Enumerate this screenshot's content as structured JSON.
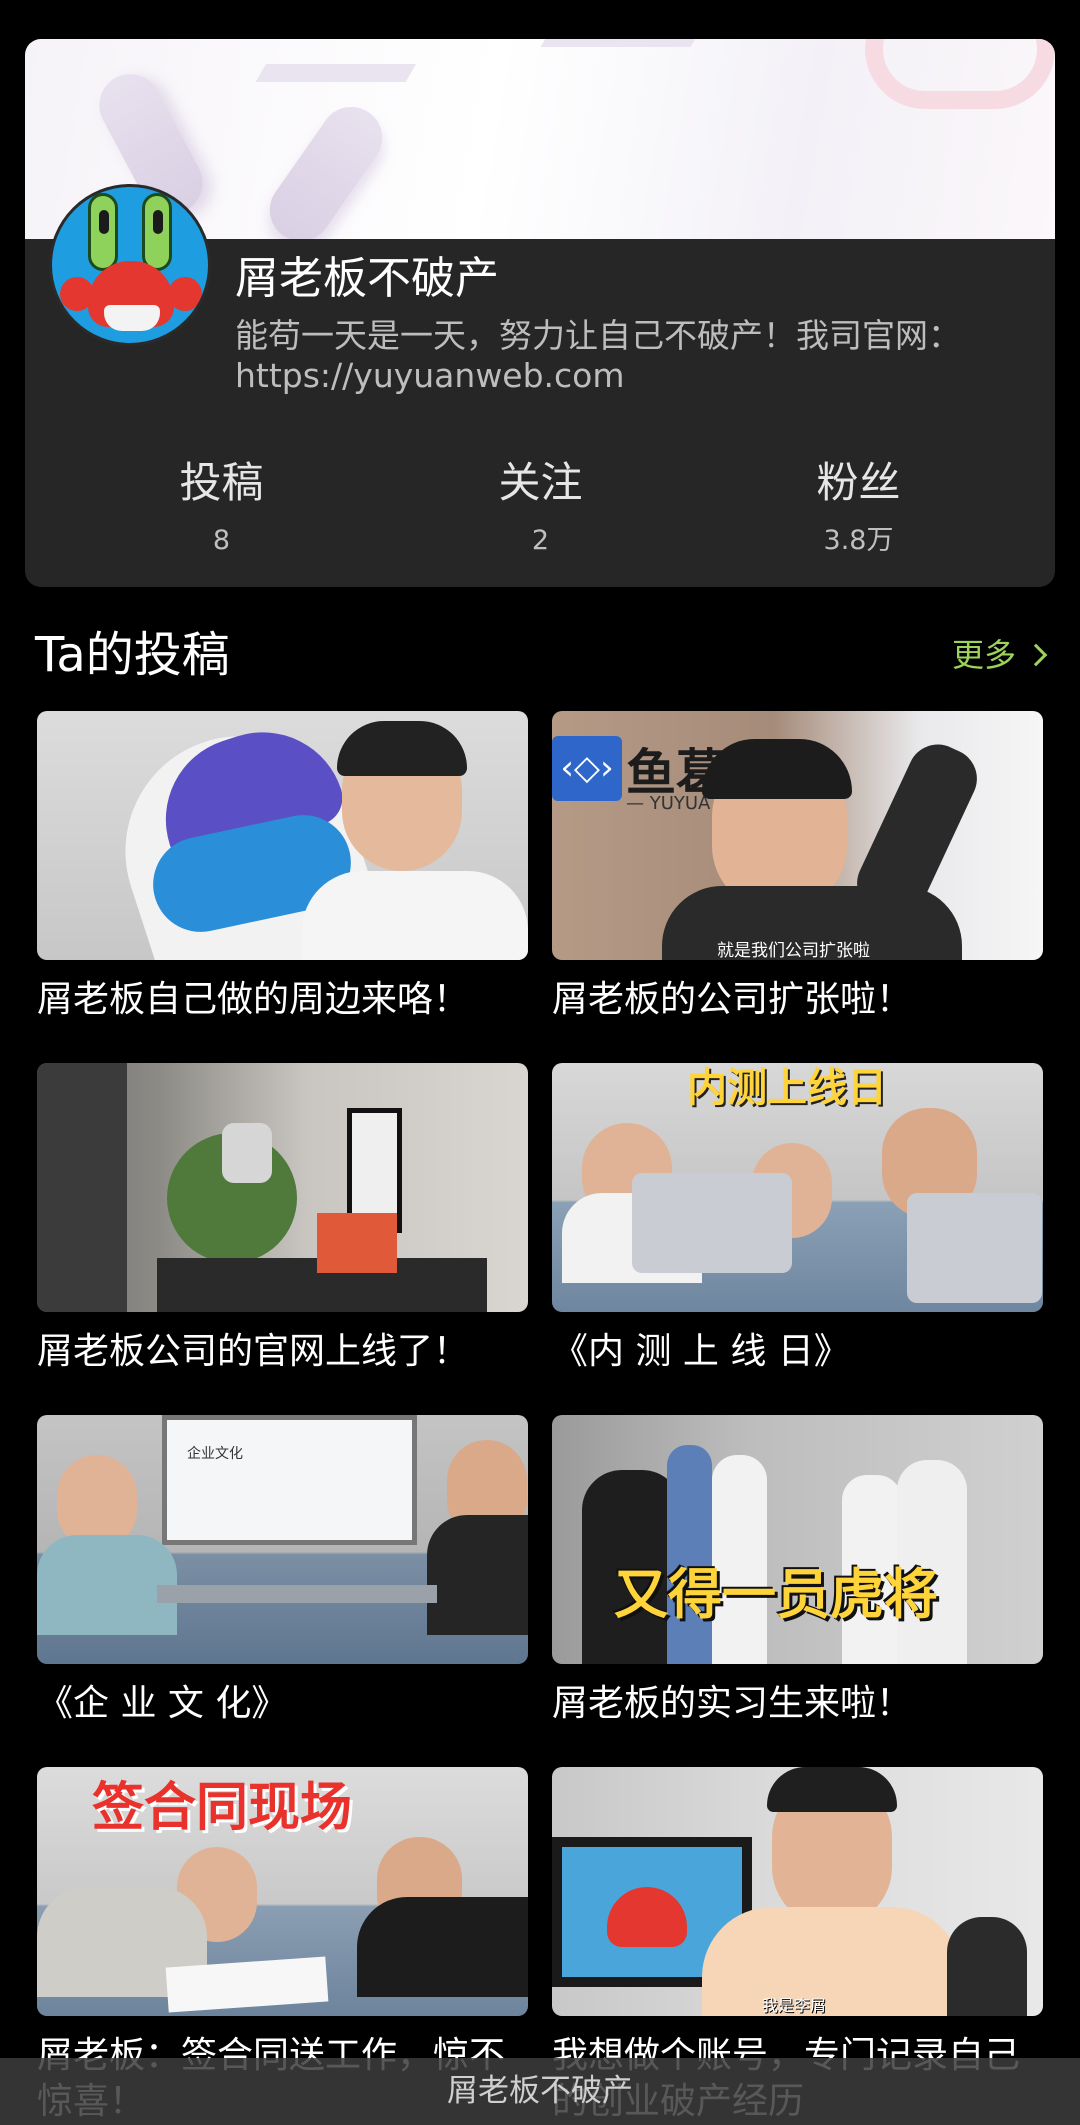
{
  "profile": {
    "name": "屑老板不破产",
    "bio": "能苟一天是一天，努力让自己不破产！我司官网：https://yuyuanweb.com",
    "stats": [
      {
        "label": "投稿",
        "value": "8"
      },
      {
        "label": "关注",
        "value": "2"
      },
      {
        "label": "粉丝",
        "value": "3.8万"
      }
    ]
  },
  "section": {
    "title": "Ta的投稿",
    "more_label": "更多"
  },
  "videos": [
    {
      "title": "屑老板自己做的周边来咯！",
      "overlay": ""
    },
    {
      "title": "屑老板的公司扩张啦！",
      "overlay": "就是我们公司扩张啦",
      "sign": "鱼葛",
      "sign_sub": "— YUYUA"
    },
    {
      "title": "屑老板公司的官网上线了！",
      "overlay": ""
    },
    {
      "title": "《内 测 上 线 日》",
      "overlay": "内测上线日"
    },
    {
      "title": "《企 业 文 化》",
      "overlay": "企业文化"
    },
    {
      "title": "屑老板的实习生来啦！",
      "overlay": "又得一员虎将"
    },
    {
      "title": "屑老板：签合同送工作，惊不惊喜！",
      "overlay": "签合同现场"
    },
    {
      "title": "我想做个账号，专门记录自己的创业破产经历",
      "overlay": "我是李屑"
    }
  ],
  "bottom_bar": {
    "title": "屑老板不破产"
  },
  "colors": {
    "background": "#000000",
    "card": "#262626",
    "accent_green": "#9ed35a",
    "overlay_yellow": "#ffd43b",
    "overlay_red": "#e8322b"
  }
}
